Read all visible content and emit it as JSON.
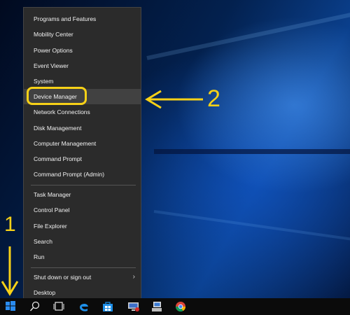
{
  "menu": {
    "items": [
      {
        "label": "Programs and Features"
      },
      {
        "label": "Mobility Center"
      },
      {
        "label": "Power Options"
      },
      {
        "label": "Event Viewer"
      },
      {
        "label": "System"
      },
      {
        "label": "Device Manager"
      },
      {
        "label": "Network Connections"
      },
      {
        "label": "Disk Management"
      },
      {
        "label": "Computer Management"
      },
      {
        "label": "Command Prompt"
      },
      {
        "label": "Command Prompt (Admin)"
      },
      {
        "label": "Task Manager"
      },
      {
        "label": "Control Panel"
      },
      {
        "label": "File Explorer"
      },
      {
        "label": "Search"
      },
      {
        "label": "Run"
      },
      {
        "label": "Shut down or sign out"
      },
      {
        "label": "Desktop"
      }
    ],
    "highlighted": "Device Manager"
  },
  "annotations": {
    "step1": "1",
    "step2": "2",
    "color": "#f7d117"
  },
  "taskbar": {
    "icons": [
      "windows-start-icon",
      "search-icon",
      "task-view-icon",
      "edge-icon",
      "store-icon",
      "remote-desktop-icon",
      "device-manager-icon",
      "chrome-icon"
    ]
  }
}
